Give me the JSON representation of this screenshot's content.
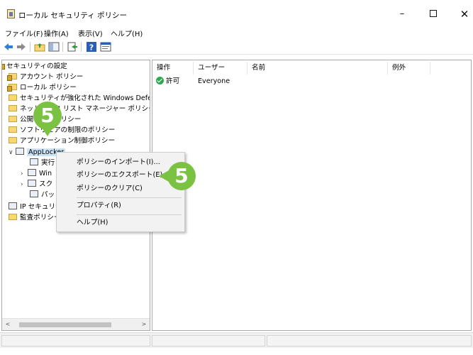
{
  "window": {
    "title": "ローカル セキュリティ ポリシー",
    "controls": {
      "minimize": "–",
      "close": "✕"
    }
  },
  "menubar": {
    "items": [
      {
        "label": "ファイル(F)"
      },
      {
        "label": "操作(A)"
      },
      {
        "label": "表示(V)"
      },
      {
        "label": "ヘルプ(H)"
      }
    ]
  },
  "toolbar": {
    "icons": [
      "back-icon",
      "forward-icon",
      "up-folder-icon",
      "show-tree-icon",
      "export-list-icon",
      "help-icon",
      "properties-icon"
    ]
  },
  "tree": {
    "root": "セキュリティの設定",
    "items": [
      {
        "label": "アカウント ポリシー"
      },
      {
        "label": "ローカル ポリシー"
      },
      {
        "label": "セキュリティが強化された Windows Defende"
      },
      {
        "label": "ネットワーク リスト マネージャー ポリシー"
      },
      {
        "label": "公開キーのポリシー"
      },
      {
        "label": "ソフトウェアの制限のポリシー"
      },
      {
        "label": "アプリケーション制御ポリシー"
      }
    ],
    "applocker": {
      "label": "AppLocker",
      "children": [
        {
          "label": "実行"
        },
        {
          "label": "Win"
        },
        {
          "label": "スク"
        },
        {
          "label": "パッ"
        }
      ]
    },
    "bottom_items": [
      {
        "label": "IP セキュリティ"
      },
      {
        "label": "監査ポリシー"
      }
    ],
    "scrollbar": {
      "left_arrow": "<",
      "right_arrow": ">"
    }
  },
  "list": {
    "columns": [
      {
        "label": "操作"
      },
      {
        "label": "ユーザー"
      },
      {
        "label": "名前"
      },
      {
        "label": "例外"
      }
    ],
    "rows": [
      {
        "action": "許可",
        "user": "Everyone",
        "name": "",
        "exception": ""
      }
    ]
  },
  "context_menu": {
    "items": [
      {
        "label": "ポリシーのインポート(I)..."
      },
      {
        "label": "ポリシーのエクスポート(E)..."
      },
      {
        "label": "ポリシーのクリア(C)"
      },
      {
        "label": "プロパティ(R)"
      },
      {
        "label": "ヘルプ(H)"
      }
    ]
  },
  "badges": {
    "step_tree": "5",
    "step_menu": "5",
    "color": "#7cc242"
  }
}
